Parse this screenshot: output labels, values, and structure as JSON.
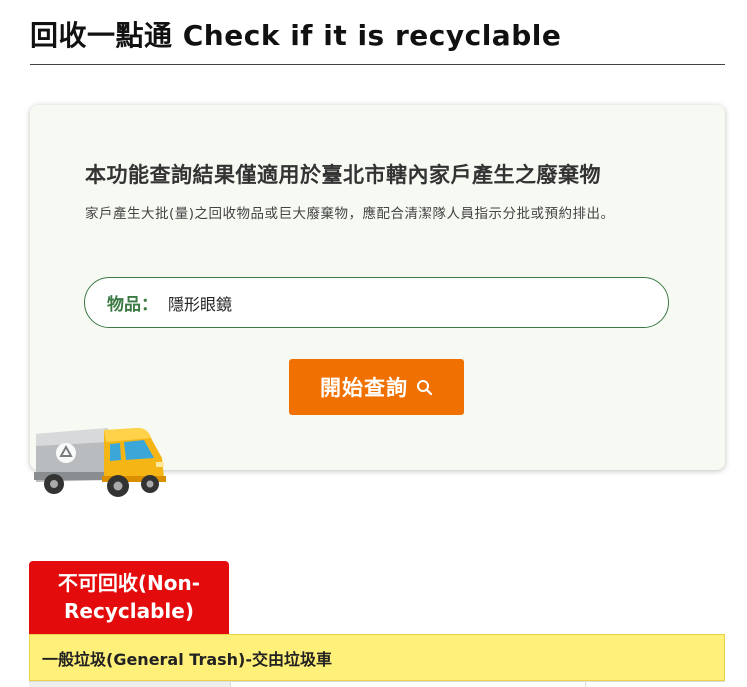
{
  "page": {
    "title": "回收一點通 Check if it is recyclable"
  },
  "query": {
    "heading": "本功能查詢結果僅適用於臺北市轄內家戶產生之廢棄物",
    "note": "家戶產生大批(量)之回收物品或巨大廢棄物，應配合清潔隊人員指示分批或預約排出。",
    "item_label": "物品：",
    "item_value": "隱形眼鏡",
    "search_button_label": "開始查詢",
    "search_icon": "search-icon"
  },
  "illustration": {
    "truck_icon": "recycling-truck-icon",
    "recycle_symbol": "recycle-icon"
  },
  "result": {
    "status_badge_line1": "不可回收(Non-",
    "status_badge_line2": "Recyclable)",
    "category": "一般垃圾(General Trash)-交由垃圾車"
  },
  "colors": {
    "accent_orange": "#f07000",
    "field_green": "#3c7a44",
    "badge_red": "#e30b0b",
    "row_yellow": "#fff07a",
    "card_bg": "#f7faf3"
  }
}
